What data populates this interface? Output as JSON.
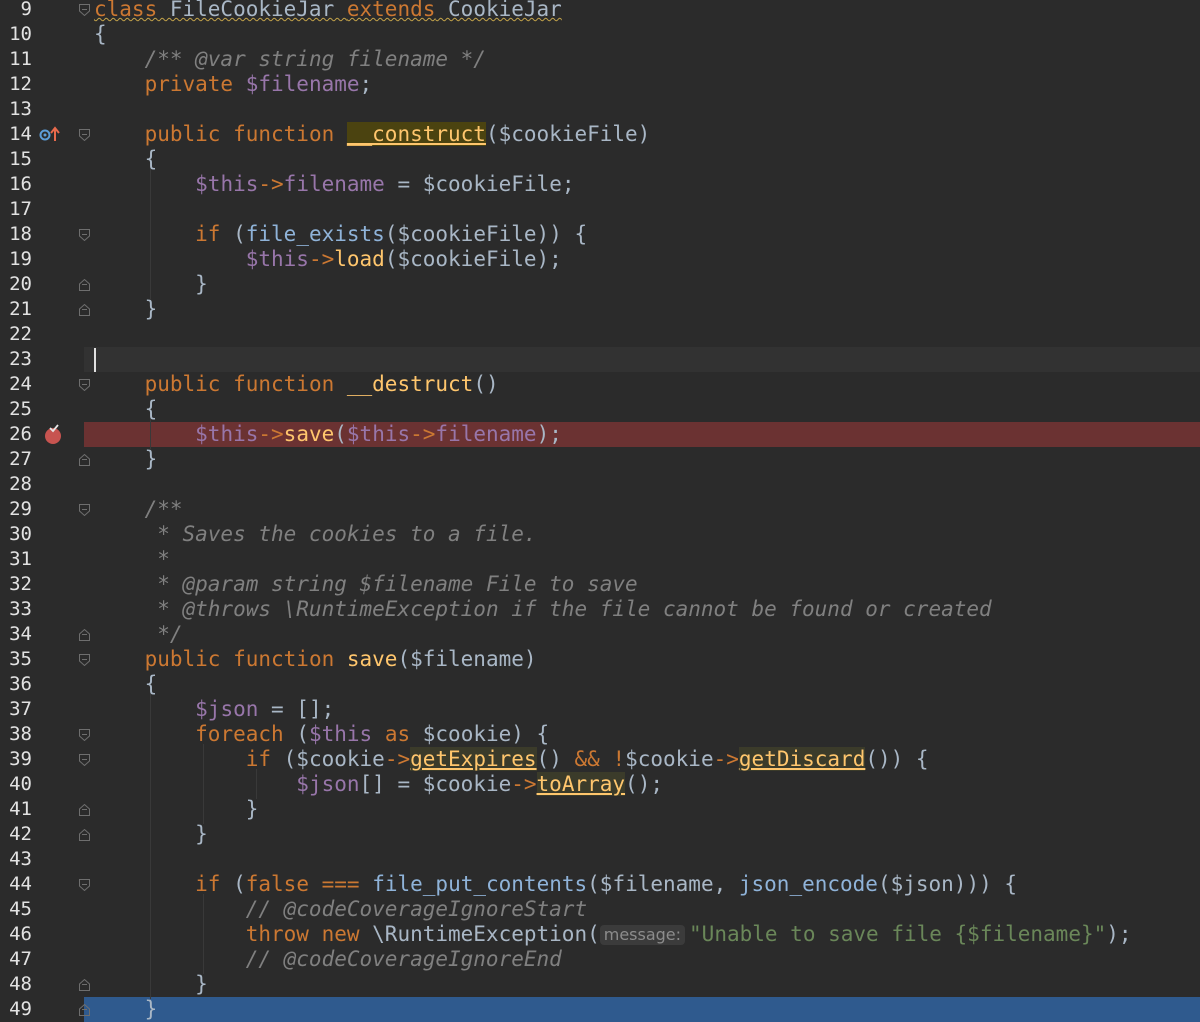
{
  "lines": [
    {
      "n": "9",
      "tokens": [
        [
          "kw wavy",
          "class"
        ],
        [
          "plain wavy",
          " FileCookieJar "
        ],
        [
          "kw wavy",
          "extends"
        ],
        [
          "plain wavy",
          " CookieJar"
        ]
      ]
    },
    {
      "n": "10",
      "tokens": [
        [
          "plain",
          "{"
        ]
      ]
    },
    {
      "n": "11",
      "tokens": [
        [
          "plain",
          "    "
        ],
        [
          "cmt",
          "/** @var string filename */"
        ]
      ]
    },
    {
      "n": "12",
      "tokens": [
        [
          "plain",
          "    "
        ],
        [
          "kw",
          "private "
        ],
        [
          "var",
          "$filename"
        ],
        [
          "plain",
          ";"
        ]
      ]
    },
    {
      "n": "13",
      "tokens": []
    },
    {
      "n": "14",
      "tokens": [
        [
          "plain",
          "    "
        ],
        [
          "kw",
          "public function "
        ],
        [
          "usage-def",
          "__construct"
        ],
        [
          "plain",
          "($cookieFile)"
        ]
      ]
    },
    {
      "n": "15",
      "tokens": [
        [
          "plain",
          "    {"
        ]
      ]
    },
    {
      "n": "16",
      "tokens": [
        [
          "plain",
          "        "
        ],
        [
          "var",
          "$this"
        ],
        [
          "kw",
          "->"
        ],
        [
          "var",
          "filename"
        ],
        [
          "plain",
          " = $cookieFile;"
        ]
      ]
    },
    {
      "n": "17",
      "tokens": []
    },
    {
      "n": "18",
      "tokens": [
        [
          "plain",
          "        "
        ],
        [
          "kw",
          "if "
        ],
        [
          "plain",
          "("
        ],
        [
          "bfn",
          "file_exists"
        ],
        [
          "plain",
          "($cookieFile)) {"
        ]
      ]
    },
    {
      "n": "19",
      "tokens": [
        [
          "plain",
          "            "
        ],
        [
          "var",
          "$this"
        ],
        [
          "kw",
          "->"
        ],
        [
          "fn",
          "load"
        ],
        [
          "plain",
          "($cookieFile);"
        ]
      ]
    },
    {
      "n": "20",
      "tokens": [
        [
          "plain",
          "        }"
        ]
      ]
    },
    {
      "n": "21",
      "tokens": [
        [
          "plain",
          "    }"
        ]
      ]
    },
    {
      "n": "22",
      "tokens": []
    },
    {
      "n": "23",
      "tokens": []
    },
    {
      "n": "24",
      "tokens": [
        [
          "plain",
          "    "
        ],
        [
          "kw",
          "public function "
        ],
        [
          "defname",
          "__destruct"
        ],
        [
          "plain",
          "()"
        ]
      ]
    },
    {
      "n": "25",
      "tokens": [
        [
          "plain",
          "    {"
        ]
      ]
    },
    {
      "n": "26",
      "tokens": [
        [
          "plain",
          "        "
        ],
        [
          "var",
          "$this"
        ],
        [
          "kw",
          "->"
        ],
        [
          "fn",
          "save"
        ],
        [
          "plain",
          "("
        ],
        [
          "var",
          "$this"
        ],
        [
          "kw",
          "->"
        ],
        [
          "var",
          "filename"
        ],
        [
          "plain",
          ");"
        ]
      ]
    },
    {
      "n": "27",
      "tokens": [
        [
          "plain",
          "    }"
        ]
      ]
    },
    {
      "n": "28",
      "tokens": []
    },
    {
      "n": "29",
      "tokens": [
        [
          "plain",
          "    "
        ],
        [
          "cmt",
          "/**"
        ]
      ]
    },
    {
      "n": "30",
      "tokens": [
        [
          "plain",
          "     "
        ],
        [
          "cmt",
          "* Saves the cookies to a file."
        ]
      ]
    },
    {
      "n": "31",
      "tokens": [
        [
          "plain",
          "     "
        ],
        [
          "cmt",
          "*"
        ]
      ]
    },
    {
      "n": "32",
      "tokens": [
        [
          "plain",
          "     "
        ],
        [
          "cmt",
          "* @param string $filename File to save"
        ]
      ]
    },
    {
      "n": "33",
      "tokens": [
        [
          "plain",
          "     "
        ],
        [
          "cmt",
          "* @throws \\RuntimeException if the file cannot be found or created"
        ]
      ]
    },
    {
      "n": "34",
      "tokens": [
        [
          "plain",
          "     "
        ],
        [
          "cmt",
          "*/"
        ]
      ]
    },
    {
      "n": "35",
      "tokens": [
        [
          "plain",
          "    "
        ],
        [
          "kw",
          "public function "
        ],
        [
          "defname",
          "save"
        ],
        [
          "plain",
          "($filename)"
        ]
      ]
    },
    {
      "n": "36",
      "tokens": [
        [
          "plain",
          "    {"
        ]
      ]
    },
    {
      "n": "37",
      "tokens": [
        [
          "plain",
          "        "
        ],
        [
          "var",
          "$json"
        ],
        [
          "plain",
          " = [];"
        ]
      ]
    },
    {
      "n": "38",
      "tokens": [
        [
          "plain",
          "        "
        ],
        [
          "kw",
          "foreach "
        ],
        [
          "plain",
          "("
        ],
        [
          "var",
          "$this"
        ],
        [
          "kw",
          " as "
        ],
        [
          "plain",
          "$cookie) {"
        ]
      ]
    },
    {
      "n": "39",
      "tokens": [
        [
          "plain",
          "            "
        ],
        [
          "kw",
          "if "
        ],
        [
          "plain",
          "($cookie"
        ],
        [
          "kw",
          "->"
        ],
        [
          "usage",
          "getExpires"
        ],
        [
          "plain",
          "() "
        ],
        [
          "kw",
          "&&"
        ],
        [
          "plain",
          " "
        ],
        [
          "kw",
          "!"
        ],
        [
          "plain",
          "$cookie"
        ],
        [
          "kw",
          "->"
        ],
        [
          "usage",
          "getDiscard"
        ],
        [
          "plain",
          "()) {"
        ]
      ]
    },
    {
      "n": "40",
      "tokens": [
        [
          "plain",
          "                "
        ],
        [
          "var",
          "$json"
        ],
        [
          "plain",
          "[] = $cookie"
        ],
        [
          "kw",
          "->"
        ],
        [
          "usage",
          "toArray"
        ],
        [
          "plain",
          "();"
        ]
      ]
    },
    {
      "n": "41",
      "tokens": [
        [
          "plain",
          "            }"
        ]
      ]
    },
    {
      "n": "42",
      "tokens": [
        [
          "plain",
          "        }"
        ]
      ]
    },
    {
      "n": "43",
      "tokens": []
    },
    {
      "n": "44",
      "tokens": [
        [
          "plain",
          "        "
        ],
        [
          "kw",
          "if "
        ],
        [
          "plain",
          "("
        ],
        [
          "kw",
          "false"
        ],
        [
          "plain",
          " "
        ],
        [
          "kw",
          "==="
        ],
        [
          "plain",
          " "
        ],
        [
          "bfn",
          "file_put_contents"
        ],
        [
          "plain",
          "($filename, "
        ],
        [
          "bfn",
          "json_encode"
        ],
        [
          "plain",
          "($json))) {"
        ]
      ]
    },
    {
      "n": "45",
      "tokens": [
        [
          "plain",
          "            "
        ],
        [
          "cmt",
          "// @codeCoverageIgnoreStart"
        ]
      ]
    },
    {
      "n": "46",
      "tokens": [
        [
          "plain",
          "            "
        ],
        [
          "kw",
          "throw new "
        ],
        [
          "plain",
          "\\RuntimeException("
        ],
        [
          "hint",
          "message:"
        ],
        [
          "str",
          "\"Unable to save file {$filename}\""
        ],
        [
          "plain",
          ");"
        ]
      ]
    },
    {
      "n": "47",
      "tokens": [
        [
          "plain",
          "            "
        ],
        [
          "cmt",
          "// @codeCoverageIgnoreEnd"
        ]
      ]
    },
    {
      "n": "48",
      "tokens": [
        [
          "plain",
          "        }"
        ]
      ]
    },
    {
      "n": "49",
      "tokens": [
        [
          "plain",
          "    }"
        ]
      ]
    }
  ]
}
